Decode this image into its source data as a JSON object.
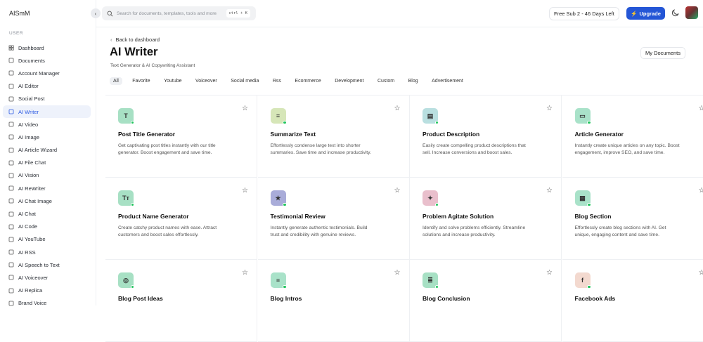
{
  "app": {
    "name": "AISmM"
  },
  "sidebar": {
    "section_label": "USER",
    "items": [
      {
        "label": "Dashboard",
        "icon": "grid-icon"
      },
      {
        "label": "Documents",
        "icon": "archive-icon"
      },
      {
        "label": "Account Manager",
        "icon": "sitemap-icon"
      },
      {
        "label": "AI Editor",
        "icon": "edit-icon"
      },
      {
        "label": "Social Post",
        "icon": "chat-icon"
      },
      {
        "label": "AI Writer",
        "icon": "document-icon",
        "active": true
      },
      {
        "label": "AI Video",
        "icon": "video-icon"
      },
      {
        "label": "AI Image",
        "icon": "image-icon"
      },
      {
        "label": "AI Article Wizard",
        "icon": "wizard-icon"
      },
      {
        "label": "AI File Chat",
        "icon": "file-icon"
      },
      {
        "label": "AI Vision",
        "icon": "vision-icon"
      },
      {
        "label": "AI ReWriter",
        "icon": "pen-icon"
      },
      {
        "label": "AI Chat Image",
        "icon": "chat-image-icon"
      },
      {
        "label": "AI Chat",
        "icon": "message-icon"
      },
      {
        "label": "AI Code",
        "icon": "terminal-icon"
      },
      {
        "label": "AI YouTube",
        "icon": "youtube-icon"
      },
      {
        "label": "AI RSS",
        "icon": "rss-icon"
      },
      {
        "label": "AI Speech to Text",
        "icon": "microphone-icon"
      },
      {
        "label": "AI Voiceover",
        "icon": "voiceover-icon"
      },
      {
        "label": "AI Replica",
        "icon": "replica-icon"
      },
      {
        "label": "Brand Voice",
        "icon": "brand-icon"
      }
    ]
  },
  "topbar": {
    "search_placeholder": "Search for documents, templates, tools and more",
    "search_shortcut": "ctrl + K",
    "subscription": "Free Sub 2 - 46 Days Left",
    "upgrade_label": "Upgrade"
  },
  "page": {
    "back_link": "Back to dashboard",
    "title": "AI Writer",
    "subtitle": "Text Generator & AI Copywriting Assistant",
    "my_documents": "My Documents"
  },
  "filters": [
    "All",
    "Favorite",
    "Youtube",
    "Voiceover",
    "Social media",
    "Rss",
    "Ecommerce",
    "Development",
    "Custom",
    "Blog",
    "Advertisement"
  ],
  "active_filter": "All",
  "cards": [
    {
      "title": "Post Title Generator",
      "description": "Get captivating post titles instantly with our title generator. Boost engagement and save time.",
      "icon": "text-icon",
      "glyph": "T",
      "color": "#a7e0c4"
    },
    {
      "title": "Summarize Text",
      "description": "Effortlessly condense large text into shorter summaries. Save time and increase productivity.",
      "icon": "lines-icon",
      "glyph": "≡",
      "color": "#d6e6b8"
    },
    {
      "title": "Product Description",
      "description": "Easily create compelling product descriptions that sell. Increase conversions and boost sales.",
      "icon": "file-icon",
      "glyph": "▤",
      "color": "#b9dfe0"
    },
    {
      "title": "Article Generator",
      "description": "Instantly create unique articles on any topic. Boost engagement, improve SEO, and save time.",
      "icon": "browser-icon",
      "glyph": "▭",
      "color": "#a9e2c9"
    },
    {
      "title": "Product Name Generator",
      "description": "Create catchy product names with ease. Attract customers and boost sales effortlessly.",
      "icon": "typography-icon",
      "glyph": "Tт",
      "color": "#a7e0c4"
    },
    {
      "title": "Testimonial Review",
      "description": "Instantly generate authentic testimonials. Build trust and credibility with genuine reviews.",
      "icon": "star-icon",
      "glyph": "★",
      "color": "#a9acd9"
    },
    {
      "title": "Problem Agitate Solution",
      "description": "Identify and solve problems efficiently. Streamline solutions and increase productivity.",
      "icon": "sparkle-icon",
      "glyph": "✦",
      "color": "#e9bfcc"
    },
    {
      "title": "Blog Section",
      "description": "Effortlessly create blog sections with AI. Get unique, engaging content and save time.",
      "icon": "layout-icon",
      "glyph": "▦",
      "color": "#a9e2c9"
    },
    {
      "title": "Blog Post Ideas",
      "description": "",
      "icon": "bulb-icon",
      "glyph": "◎",
      "color": "#a7e0c4"
    },
    {
      "title": "Blog Intros",
      "description": "",
      "icon": "align-icon",
      "glyph": "≡",
      "color": "#a9e2c9"
    },
    {
      "title": "Blog Conclusion",
      "description": "",
      "icon": "align-center-icon",
      "glyph": "≣",
      "color": "#a7e0c4"
    },
    {
      "title": "Facebook Ads",
      "description": "",
      "icon": "facebook-icon",
      "glyph": "f",
      "color": "#f3d9cf"
    }
  ],
  "colors": {
    "accent": "#2456d6",
    "active_bg": "#eef2fb",
    "online_dot": "#22c55e"
  }
}
